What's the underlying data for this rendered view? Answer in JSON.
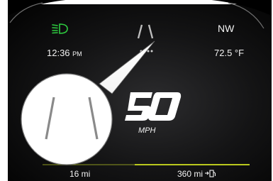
{
  "cluster": {
    "headlight_icon": "low-beam-headlight-indicator",
    "headlight_icon_color": "#2ecc40",
    "lane_icon": "lane-keep-assist-indicator",
    "compass": "NW",
    "clock": {
      "time": "12:36",
      "period": "PM"
    },
    "temperature": "72.5 °F",
    "page_dots_count": 4,
    "speed": {
      "value": "50",
      "unit": "MPH"
    },
    "trip": "16 mi",
    "range": {
      "value": "360 mi",
      "icon": "fuel-range-icon"
    },
    "accent_color": "#b9c81e"
  },
  "callout": {
    "icon": "lane-keep-assist-magnified"
  }
}
